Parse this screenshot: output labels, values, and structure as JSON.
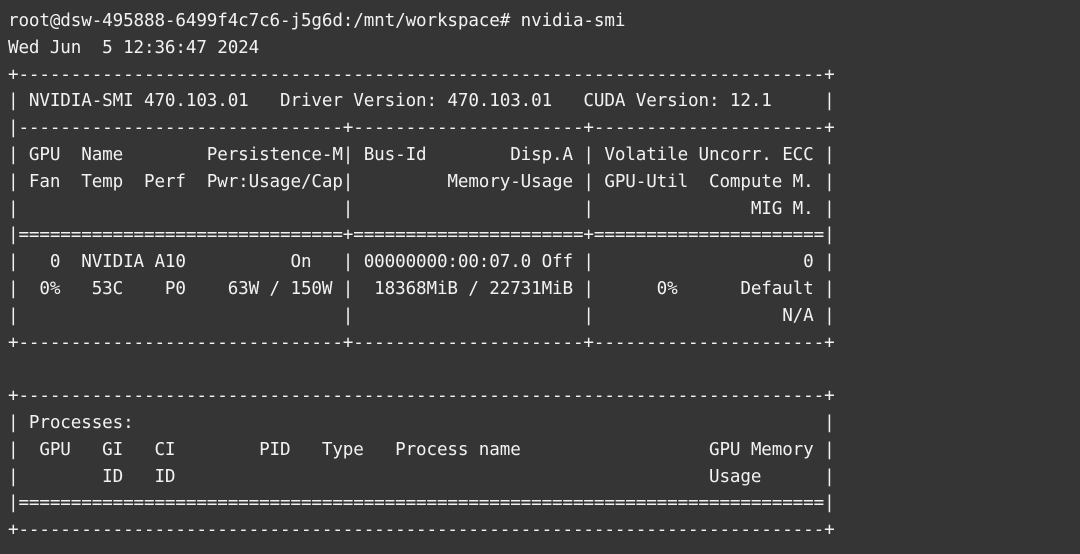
{
  "terminal": {
    "background_color": "#353535",
    "foreground_color": "#f2f2f2",
    "columns": 80,
    "prompt_line": "root@dsw-495888-6499f4c7c6-j5g6d:/mnt/workspace# nvidia-smi",
    "prompt": {
      "user": "root",
      "host": "dsw-495888-6499f4c7c6-j5g6d",
      "cwd": "/mnt/workspace",
      "symbol": "#",
      "command": "nvidia-smi"
    },
    "date_line": "Wed Jun  5 12:36:47 2024"
  },
  "smi": {
    "border_top": "+-----------------------------------------------------------------------------+",
    "title_line": "| NVIDIA-SMI 470.103.01   Driver Version: 470.103.01   CUDA Version: 12.1     |",
    "title_fields": {
      "smi_label": "NVIDIA-SMI",
      "smi_version": "470.103.01",
      "driver_label": "Driver Version:",
      "driver_version": "470.103.01",
      "cuda_label": "CUDA Version:",
      "cuda_version": "12.1"
    },
    "header_sep": "|-------------------------------+----------------------+----------------------+",
    "header_row_1": "| GPU  Name        Persistence-M| Bus-Id        Disp.A | Volatile Uncorr. ECC |",
    "header_row_2": "| Fan  Temp  Perf  Pwr:Usage/Cap|         Memory-Usage | GPU-Util  Compute M. |",
    "header_row_3": "|                               |                      |               MIG M. |",
    "header_double_sep": "|===============================+======================+======================|",
    "gpu_row_1": "|   0  NVIDIA A10          On   | 00000000:00:07.0 Off |                    0 |",
    "gpu_row_2": "|  0%   53C    P0    63W / 150W |  18368MiB / 22731MiB |      0%      Default |",
    "gpu_row_3": "|                               |                      |                  N/A |",
    "border_bottom": "+-------------------------------+----------------------+----------------------+",
    "columns": {
      "gpu": "GPU",
      "name": "Name",
      "persistence_m": "Persistence-M",
      "bus_id": "Bus-Id",
      "disp_a": "Disp.A",
      "volatile_uncorr_ecc": "Volatile Uncorr. ECC",
      "fan": "Fan",
      "temp": "Temp",
      "perf": "Perf",
      "pwr_usage_cap": "Pwr:Usage/Cap",
      "memory_usage": "Memory-Usage",
      "gpu_util": "GPU-Util",
      "compute_m": "Compute M.",
      "mig_m": "MIG M."
    },
    "gpu_values": {
      "index": "0",
      "name": "NVIDIA A10",
      "persistence_m": "On",
      "bus_id": "00000000:00:07.0",
      "disp_a": "Off",
      "ecc": "0",
      "fan": "0%",
      "temp": "53C",
      "perf": "P0",
      "pwr_usage": "63W",
      "pwr_cap": "150W",
      "memory_used": "18368MiB",
      "memory_total": "22731MiB",
      "gpu_util": "0%",
      "compute_m": "Default",
      "mig_m": "N/A"
    }
  },
  "processes": {
    "border_top": "+-----------------------------------------------------------------------------+",
    "title_line": "| Processes:                                                                  |",
    "header_row_1": "|  GPU   GI   CI        PID   Type   Process name                  GPU Memory |",
    "header_row_2": "|        ID   ID                                                   Usage      |",
    "header_double_sep": "|=============================================================================|",
    "border_bottom": "+-----------------------------------------------------------------------------+",
    "title": "Processes:",
    "columns": {
      "gpu": "GPU",
      "gi_id": "GI\nID",
      "ci_id": "CI\nID",
      "pid": "PID",
      "type": "Type",
      "process_name": "Process name",
      "gpu_memory_usage": "GPU Memory\nUsage"
    },
    "rows": []
  }
}
